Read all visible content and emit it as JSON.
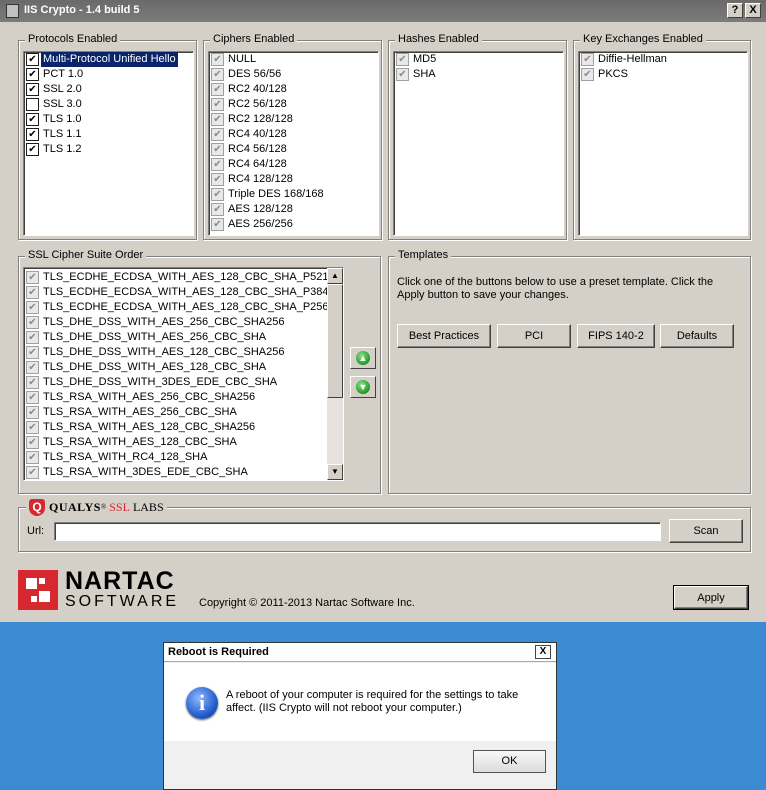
{
  "window": {
    "title": "IIS Crypto - 1.4 build 5",
    "help_btn": "?",
    "close_btn": "X"
  },
  "protocols": {
    "legend": "Protocols Enabled",
    "items": [
      {
        "label": "Multi-Protocol Unified Hello",
        "checked": "✔",
        "selected": true
      },
      {
        "label": "PCT 1.0",
        "checked": "✔"
      },
      {
        "label": "SSL 2.0",
        "checked": "✔"
      },
      {
        "label": "SSL 3.0",
        "checked": ""
      },
      {
        "label": "TLS 1.0",
        "checked": "✔"
      },
      {
        "label": "TLS 1.1",
        "checked": "✔"
      },
      {
        "label": "TLS 1.2",
        "checked": "✔"
      }
    ]
  },
  "ciphers": {
    "legend": "Ciphers Enabled",
    "items": [
      "NULL",
      "DES 56/56",
      "RC2 40/128",
      "RC2 56/128",
      "RC2 128/128",
      "RC4 40/128",
      "RC4 56/128",
      "RC4 64/128",
      "RC4 128/128",
      "Triple DES 168/168",
      "AES 128/128",
      "AES 256/256"
    ]
  },
  "hashes": {
    "legend": "Hashes Enabled",
    "items": [
      "MD5",
      "SHA"
    ]
  },
  "key_exchanges": {
    "legend": "Key Exchanges Enabled",
    "items": [
      "Diffie-Hellman",
      "PKCS"
    ]
  },
  "suites": {
    "legend": "SSL Cipher Suite Order",
    "items": [
      "TLS_ECDHE_ECDSA_WITH_AES_128_CBC_SHA_P521",
      "TLS_ECDHE_ECDSA_WITH_AES_128_CBC_SHA_P384",
      "TLS_ECDHE_ECDSA_WITH_AES_128_CBC_SHA_P256",
      "TLS_DHE_DSS_WITH_AES_256_CBC_SHA256",
      "TLS_DHE_DSS_WITH_AES_256_CBC_SHA",
      "TLS_DHE_DSS_WITH_AES_128_CBC_SHA256",
      "TLS_DHE_DSS_WITH_AES_128_CBC_SHA",
      "TLS_DHE_DSS_WITH_3DES_EDE_CBC_SHA",
      "TLS_RSA_WITH_AES_256_CBC_SHA256",
      "TLS_RSA_WITH_AES_256_CBC_SHA",
      "TLS_RSA_WITH_AES_128_CBC_SHA256",
      "TLS_RSA_WITH_AES_128_CBC_SHA",
      "TLS_RSA_WITH_RC4_128_SHA",
      "TLS_RSA_WITH_3DES_EDE_CBC_SHA"
    ],
    "check": "✔"
  },
  "templates": {
    "legend": "Templates",
    "description": "Click one of the buttons below to use a preset template. Click the Apply button to save your changes.",
    "buttons": [
      "Best Practices",
      "PCI",
      "FIPS 140-2",
      "Defaults"
    ]
  },
  "ssllabs": {
    "brand_q": "Q",
    "brand_qualys": "QUALYS",
    "brand_ssl": "SSL",
    "brand_labs": "LABS",
    "url_label": "Url:",
    "url_value": "",
    "scan_button": "Scan"
  },
  "footer": {
    "logo_top": "NARTAC",
    "logo_bottom": "SOFTWARE",
    "copyright": "Copyright © 2011-2013 Nartac Software Inc.",
    "apply_button": "Apply"
  },
  "dialog": {
    "title": "Reboot is Required",
    "close": "X",
    "info_glyph": "i",
    "message": "A reboot of your computer is required for the settings to take affect.  (IIS Crypto will not reboot your computer.)",
    "ok_button": "OK"
  },
  "colors": {
    "window_bg": "#d4d0c8",
    "desktop_bg": "#3a8bd1",
    "selection": "#0a246a",
    "brand_red": "#d7282f"
  }
}
